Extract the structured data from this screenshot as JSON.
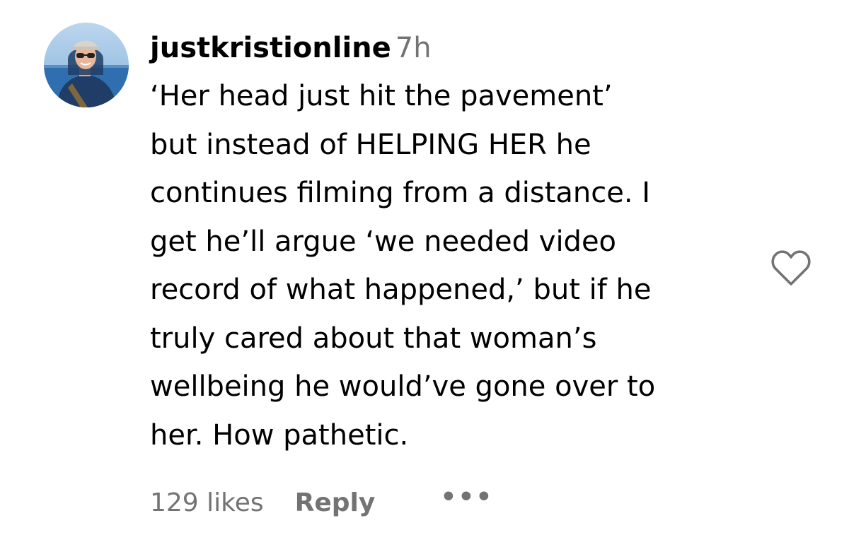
{
  "comment": {
    "username": "justkristionline",
    "time": "7h",
    "lines": [
      "‘Her head just hit the pavement’",
      "but instead of HELPING HER he",
      "continues filming from a distance. I",
      "get he’ll argue ‘we needed video",
      "record of what happened,’ but if he",
      "truly cared about that woman’s",
      "wellbeing he would’ve gone over to",
      "her. How pathetic."
    ],
    "likes": "129 likes",
    "reply_label": "Reply",
    "more_label": "•••"
  },
  "icons": {
    "like": "heart-outline-icon",
    "avatar": "profile-photo"
  },
  "colors": {
    "text": "#000000",
    "secondary": "#737373",
    "icon": "#737373",
    "background": "#ffffff"
  }
}
